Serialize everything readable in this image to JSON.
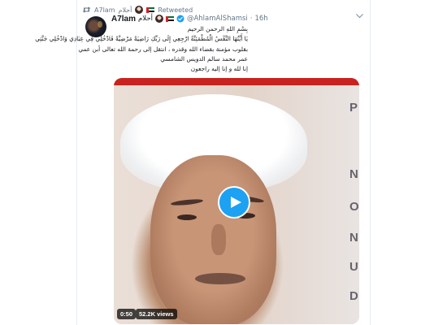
{
  "retweet": {
    "retweeter": "A7lam",
    "retweeter_arabic": "أحلام",
    "label": "Retweeted"
  },
  "author": {
    "display_name": "A7lam",
    "display_name_arabic": "أحلام",
    "handle": "@AhlamAlShamsi",
    "separator": "·",
    "time": "16h"
  },
  "tweet_text": [
    "بِسْمِ اللهِ الرحمن الرحيم",
    "يَا أَيَّتُهَا النَّفْسُ الْمُطْمَئِنَّةُ ارْجِعِي إِلَى رَبِّكِ رَاضِيَةً مَرْضِيَّةً فَادْخُلِي فِي عِبَادِي وَادْخُلِي جَنَّتِي",
    "بقلوب مؤمنة بقضاء الله وقدره ، انتقل إلى رحمة الله تعالى أبن عمي",
    "عمر محمد سالم الدويس الشامسي",
    "إنا لله و إنا إليه راجعون"
  ],
  "media": {
    "duration": "0:50",
    "views": "52.2K views",
    "doc_letters": [
      "P",
      "N",
      "O",
      "N",
      "U",
      "D"
    ]
  },
  "colors": {
    "accent": "#1da1f2",
    "muted": "#657786",
    "text": "#14171a"
  },
  "icons": [
    "retweet-icon",
    "uae-flag-icon",
    "verified-icon",
    "chevron-down-icon",
    "play-icon"
  ]
}
